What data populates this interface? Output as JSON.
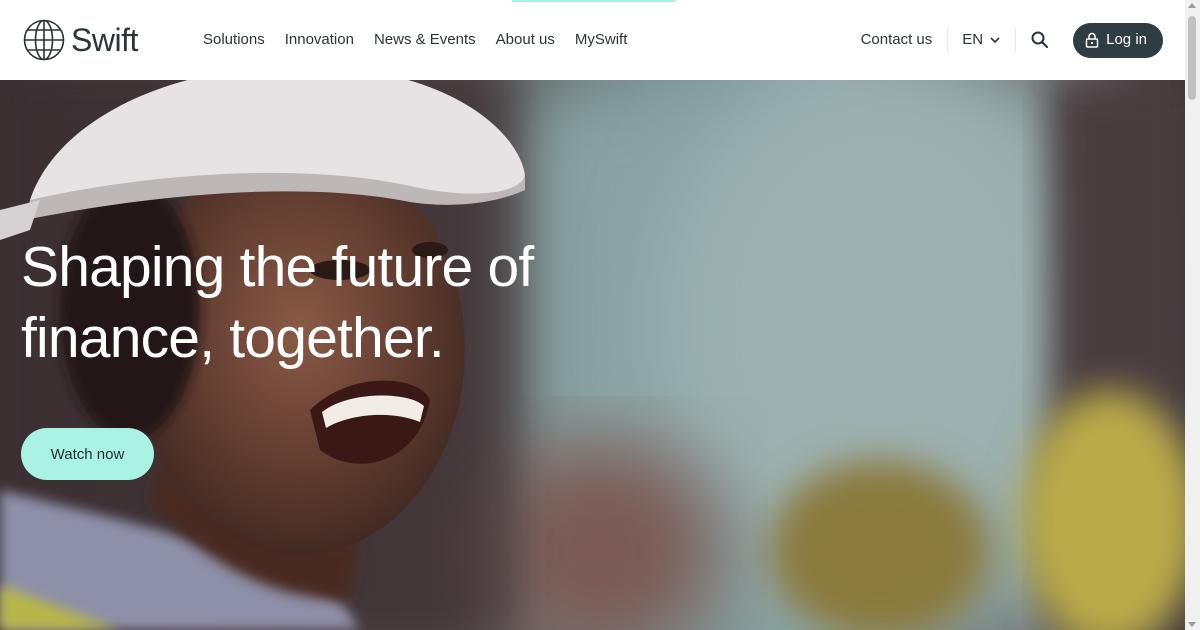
{
  "brand": {
    "name": "Swift",
    "logo_icon": "globe-icon"
  },
  "nav": {
    "items": [
      {
        "label": "Solutions"
      },
      {
        "label": "Innovation"
      },
      {
        "label": "News & Events"
      },
      {
        "label": "About us"
      },
      {
        "label": "MySwift"
      }
    ]
  },
  "utility": {
    "contact_label": "Contact us",
    "language_label": "EN",
    "language_icon": "chevron-down-icon",
    "search_icon": "search-icon",
    "login_label": "Log in",
    "login_icon": "lock-icon"
  },
  "hero": {
    "title_line1": "Shaping the future of",
    "title_line2": "finance, together.",
    "cta_label": "Watch now",
    "image": "smiling-woman-wearing-white-hard-hat"
  },
  "colors": {
    "accent": "#aaf3e2",
    "text_dark": "#2b3437",
    "login_bg": "#2e3d41",
    "hero_text": "#ffffff"
  }
}
